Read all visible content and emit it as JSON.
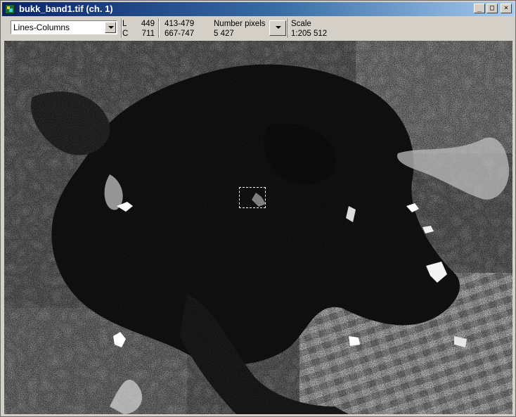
{
  "window": {
    "title": "bukk_band1.tif (ch. 1)"
  },
  "window_buttons": {
    "minimize": "_",
    "maximize": "□",
    "close": "×"
  },
  "toolbar": {
    "mode_select": "Lines-Columns",
    "line": {
      "label": "L",
      "value": "449",
      "range": "413-479"
    },
    "column": {
      "label": "C",
      "value": "711",
      "range": "667-747"
    },
    "number_pixels": {
      "label": "Number pixels",
      "value": "5 427"
    },
    "scale": {
      "label": "Scale",
      "value": "1:205 512"
    }
  }
}
